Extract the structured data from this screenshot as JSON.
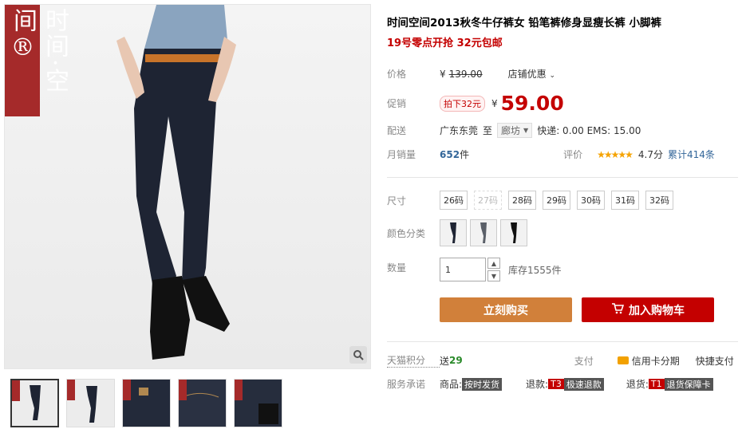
{
  "brand": {
    "logo_text": "时间·空间®"
  },
  "product": {
    "title": "时间空间2013秋冬牛仔裤女 铅笔裤修身显瘦长裤 小脚裤",
    "subtitle": "19号零点开抢 32元包邮"
  },
  "price_row": {
    "label": "价格",
    "currency": "¥",
    "old_price": "139.00",
    "shop_discount": "店铺优惠"
  },
  "promo_row": {
    "label": "促销",
    "tag": "拍下32元",
    "currency": "¥",
    "price": "59.00"
  },
  "shipping_row": {
    "label": "配送",
    "from": "广东东莞",
    "to_label": "至",
    "dest": "廊坊",
    "fee": "快递: 0.00 EMS: 15.00"
  },
  "sales_row": {
    "label": "月销量",
    "count": "652",
    "unit": "件",
    "rating_label": "评价",
    "stars": "★★★★★",
    "score": "4.7分",
    "total": "累计414条"
  },
  "size": {
    "label": "尺寸",
    "options": [
      "26码",
      "27码",
      "28码",
      "29码",
      "30码",
      "31码",
      "32码"
    ],
    "disabled_index": 1
  },
  "color": {
    "label": "颜色分类"
  },
  "qty": {
    "label": "数量",
    "value": "1",
    "stock": "库存1555件"
  },
  "buttons": {
    "buy": "立刻购买",
    "cart": "加入购物车"
  },
  "points_row": {
    "label": "天猫积分",
    "gift": "送",
    "points": "29",
    "pay_label": "支付",
    "credit": "信用卡分期",
    "quick": "快捷支付"
  },
  "service_row": {
    "label": "服务承诺",
    "goods": "商品:",
    "goods_tag": "按时发货",
    "refund": "退款:",
    "refund_t": "T3",
    "refund_tag": "极速退款",
    "return": "退货:",
    "return_t": "T1",
    "return_tag": "退货保障卡"
  },
  "colors": {
    "accent": "#c40000",
    "buy": "#d1803a",
    "brand": "#a52a2a"
  },
  "icons": [
    "zoom-icon",
    "chevron-down-icon",
    "cart-icon",
    "credit-card-icon",
    "spinner-up-icon",
    "spinner-down-icon"
  ]
}
